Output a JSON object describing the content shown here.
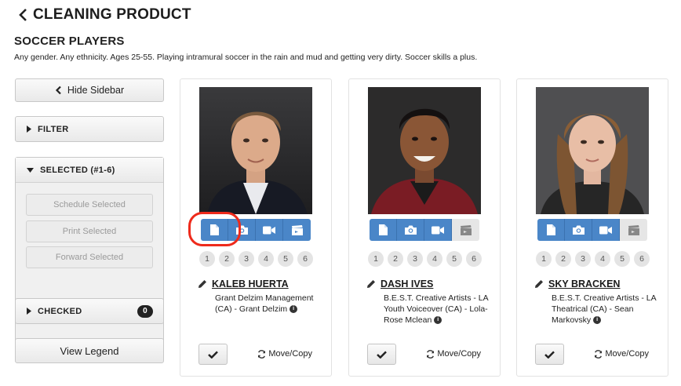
{
  "header": {
    "title": "CLEANING PRODUCT"
  },
  "role": {
    "title": "SOCCER PLAYERS",
    "description": "Any gender. Any ethnicity. Ages 25-55. Playing intramural soccer in the rain and mud and getting very dirty. Soccer skills a plus."
  },
  "sidebar": {
    "hide_label": "Hide Sidebar",
    "filter_label": "FILTER",
    "selected_label": "SELECTED (#1-6)",
    "schedule_label": "Schedule Selected",
    "print_label": "Print Selected",
    "forward_label": "Forward Selected",
    "checked_label": "CHECKED",
    "checked_count": "0",
    "legend_label": "View Legend"
  },
  "cards": [
    {
      "name": "KALEB HUERTA",
      "agency": "Grant Delzim Management (CA) - Grant Delzim",
      "numbers": [
        "1",
        "2",
        "3",
        "4",
        "5",
        "6"
      ],
      "move_copy": "Move/Copy"
    },
    {
      "name": "DASH IVES",
      "agency": "B.E.S.T. Creative Artists - LA Youth Voiceover (CA) - Lola-Rose Mclean",
      "numbers": [
        "1",
        "2",
        "3",
        "4",
        "5",
        "6"
      ],
      "move_copy": "Move/Copy"
    },
    {
      "name": "SKY BRACKEN",
      "agency": "B.E.S.T. Creative Artists - LA Theatrical (CA) - Sean Markovsky",
      "numbers": [
        "1",
        "2",
        "3",
        "4",
        "5",
        "6"
      ],
      "move_copy": "Move/Copy"
    }
  ],
  "colors": {
    "action_blue": "#4a86c8",
    "highlight_red": "#ee2a1b"
  }
}
